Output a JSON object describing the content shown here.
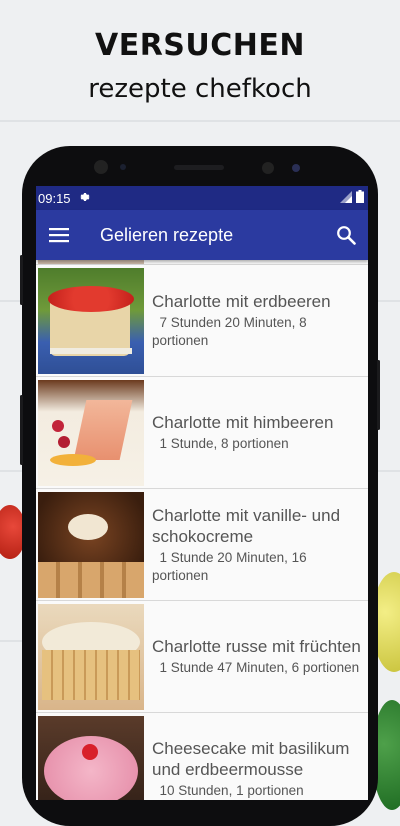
{
  "promo": {
    "headline": "VERSUCHEN",
    "subline": "rezepte chefkoch"
  },
  "status_bar": {
    "time": "09:15"
  },
  "app_bar": {
    "title": "Gelieren rezepte",
    "menu_icon": "hamburger-menu-icon",
    "search_icon": "search-icon"
  },
  "recipes": [
    {
      "name": "Charlotte mit erdbeeren",
      "meta": "7 Stunden 20 Minuten, 8 portionen",
      "image": "strawberry-charlotte-cake"
    },
    {
      "name": "Charlotte mit himbeeren",
      "meta": "1 Stunde, 8 portionen",
      "image": "raspberry-charlotte-slice"
    },
    {
      "name": "Charlotte mit vanille- und schokocreme",
      "meta": "1 Stunde 20 Minuten, 16 portionen",
      "image": "chocolate-curl-charlotte"
    },
    {
      "name": "Charlotte russe mit früchten",
      "meta": "1 Stunde 47 Minuten, 6 portionen",
      "image": "charlotte-russe-cake"
    },
    {
      "name": "Cheesecake mit basilikum und erdbeermousse",
      "meta": "10 Stunden, 1 portionen",
      "image": "strawberry-mousse-cheesecake"
    }
  ],
  "colors": {
    "status_bar": "#1f2a84",
    "app_bar": "#2b3aa0",
    "list_text": "#555555"
  }
}
